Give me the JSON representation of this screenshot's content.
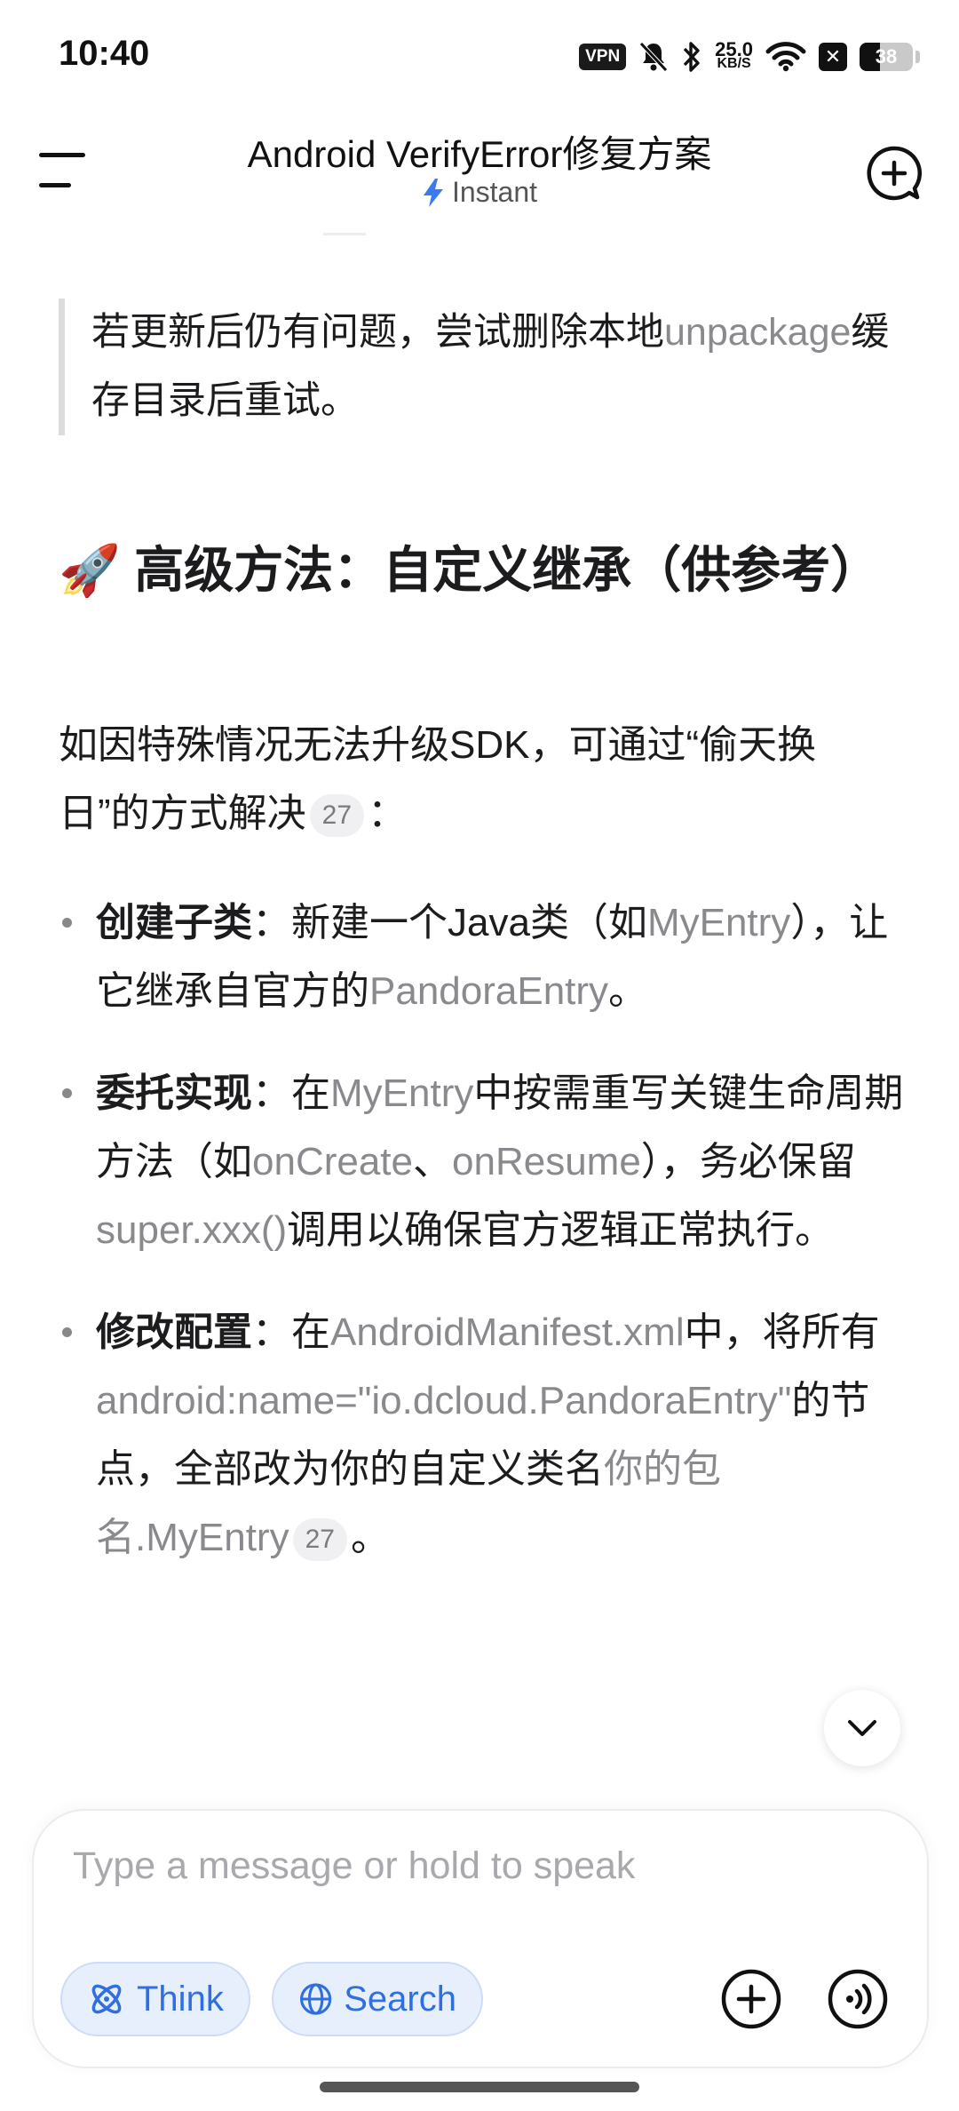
{
  "status_bar": {
    "time": "10:40",
    "vpn": "VPN",
    "net_speed_value": "25.0",
    "net_speed_unit": "KB/S",
    "battery_level": "38"
  },
  "header": {
    "title": "Android VerifyError修复方案",
    "mode": "Instant"
  },
  "content": {
    "quote_text": "若更新后仍有问题，尝试删除本地",
    "quote_code": "unpackage",
    "quote_tail": "缓存目录后重试。",
    "heading_emoji": "🚀",
    "heading": "高级方法：自定义继承（供参考）",
    "intro": "如因特殊情况无法升级SDK，可通过“偷天换日”的方式解决",
    "intro_cite": "27",
    "intro_tail": "：",
    "items": [
      {
        "label": "创建子类",
        "colon": "：",
        "t1": "新建一个Java类（如",
        "c1": "MyEntry",
        "t2": "），让它继承自官方的",
        "c2": "PandoraEntry",
        "t3": "。"
      },
      {
        "label": "委托实现",
        "colon": "：",
        "t1": "在",
        "c1": "MyEntry",
        "t2": "中按需重写关键生命周期方法（如",
        "c2": "onCreate",
        "t3": "、",
        "c3": "onResume",
        "t4": "），务必保留",
        "c4": "super.xxx()",
        "t5": "调用以确保官方逻辑正常执行。"
      },
      {
        "label": "修改配置",
        "colon": "：",
        "t1": "在",
        "c1": "AndroidManifest.xml",
        "t2": "中，将所有",
        "c2": "android:name=\"io.dcloud.PandoraEntry\"",
        "t3": "的节点，全部改为你的自定义类名",
        "c3": "你的包名.MyEntry",
        "cite": "27",
        "t4": "。"
      }
    ]
  },
  "composer": {
    "placeholder": "Type a message or hold to speak",
    "think_label": "Think",
    "search_label": "Search"
  },
  "colors": {
    "accent": "#2f6fe0",
    "chip_bg": "#e8effc",
    "code_text": "#8a8a8e"
  }
}
